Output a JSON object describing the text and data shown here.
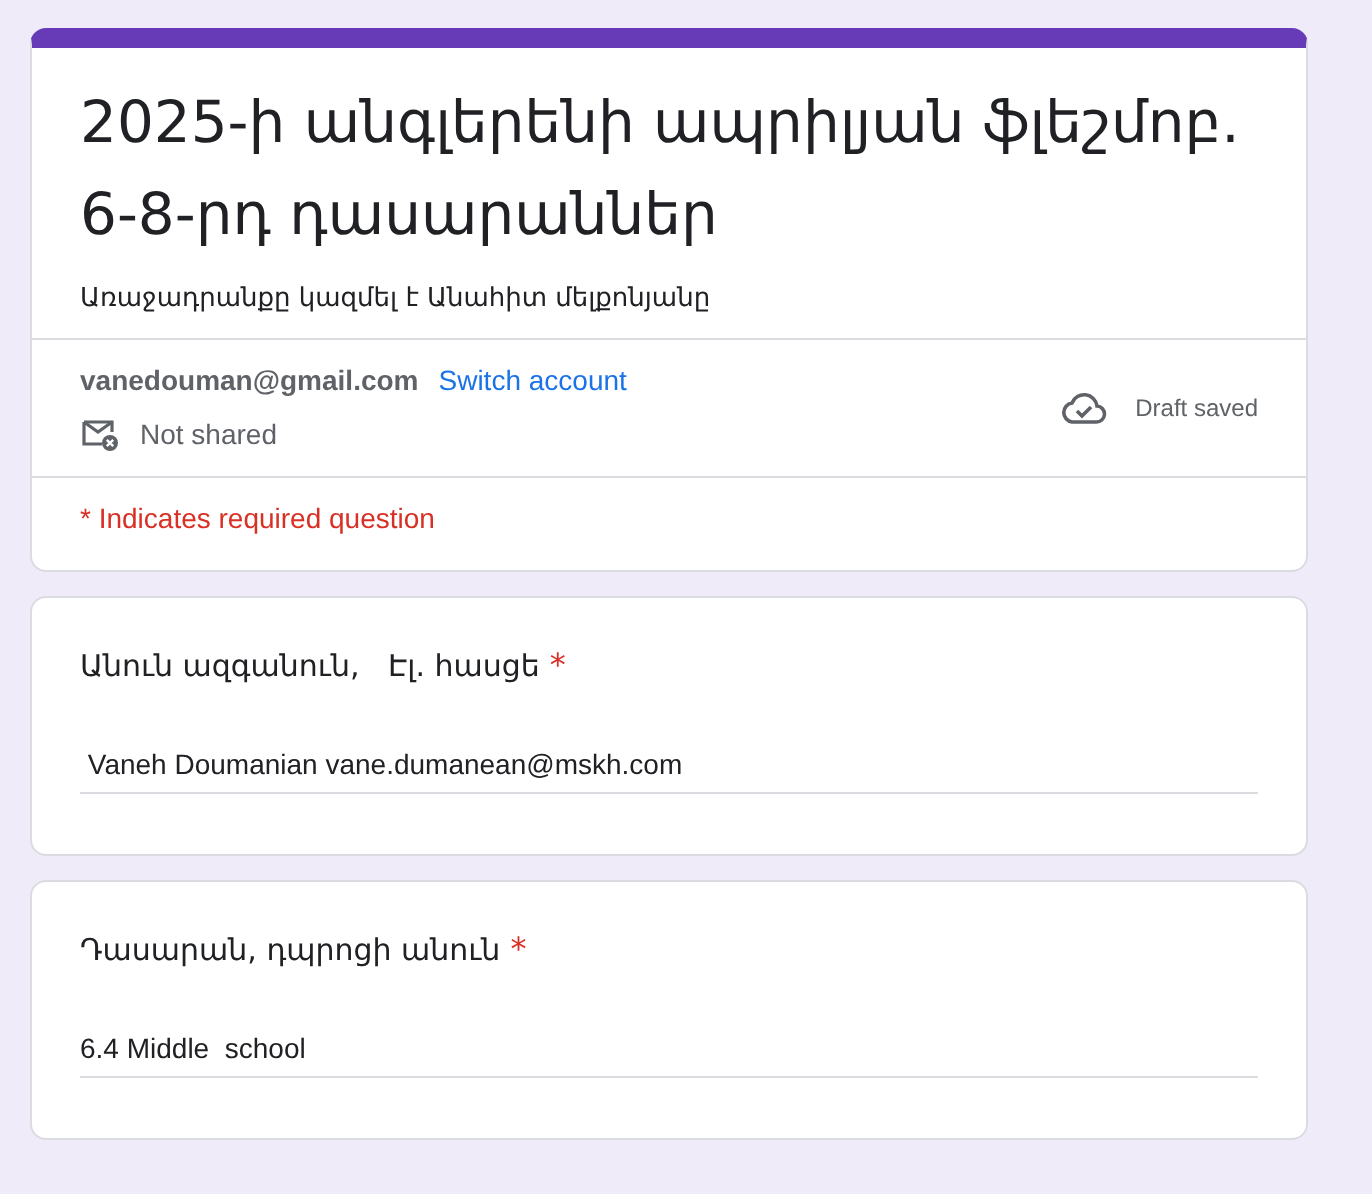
{
  "form": {
    "title": "2025-ի անգլերենի ապրիլյան ֆլեշմոբ. 6-8-րդ  դասարաններ",
    "description": "Առաջադրանքը կազմել է Անահիտ մելքոնյանը"
  },
  "account": {
    "email": "vanedouman@gmail.com",
    "switch_link": "Switch account",
    "sharing": "Not shared",
    "save_status": "Draft saved"
  },
  "required_note": "* Indicates required question",
  "questions": [
    {
      "label": "Անուն ազգանուն,   Էլ. հասցե",
      "required": true,
      "required_mark": "*",
      "value": " Vaneh Doumanian vane.dumanean@mskh.com"
    },
    {
      "label": "Դասարան, դպրոցի անուն",
      "required": true,
      "required_mark": "*",
      "value": "6.4 Middle  school"
    }
  ]
}
